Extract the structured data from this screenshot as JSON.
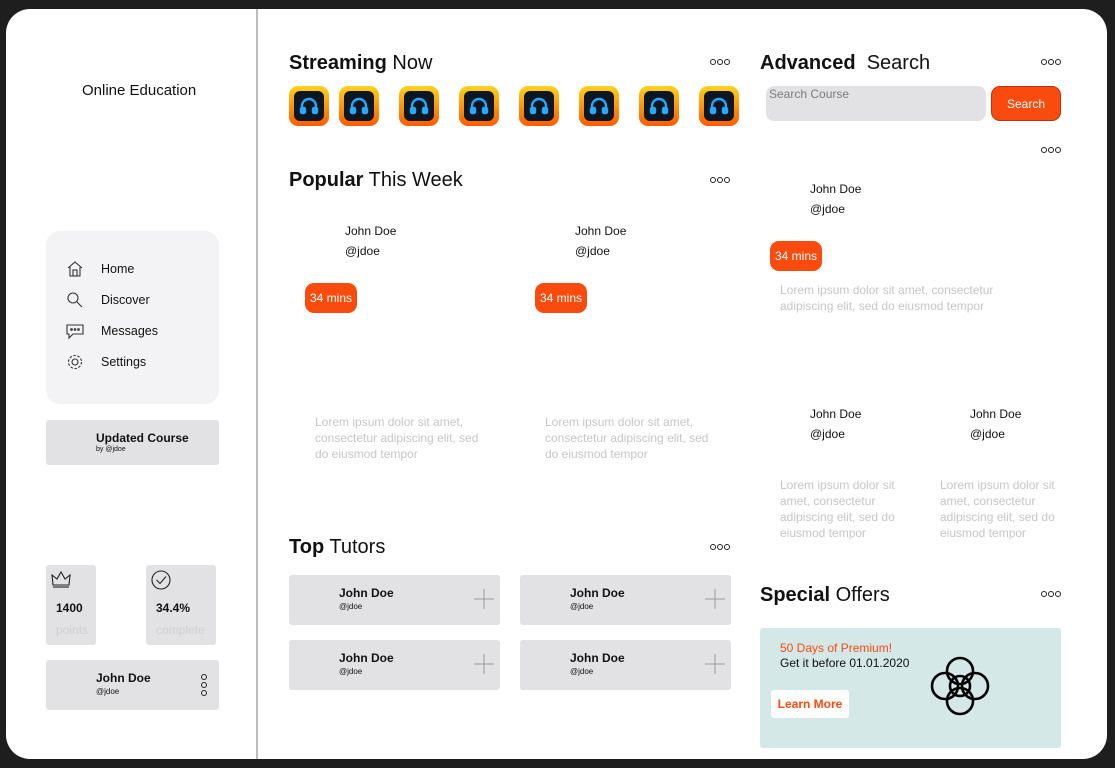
{
  "app": {
    "title": "Online Education"
  },
  "nav": {
    "items": [
      {
        "label": "Home",
        "icon": "home-icon"
      },
      {
        "label": "Discover",
        "icon": "discover-icon"
      },
      {
        "label": "Messages",
        "icon": "messages-icon"
      },
      {
        "label": "Settings",
        "icon": "settings-icon"
      }
    ]
  },
  "updated_course": {
    "title": "Updated Course",
    "by": "by @jdoe"
  },
  "stats": [
    {
      "value": "1400",
      "label": "points",
      "icon": "crown-icon"
    },
    {
      "value": "34.4%",
      "label": "complete",
      "icon": "check-circle-icon"
    }
  ],
  "profile": {
    "name": "John Doe",
    "handle": "@jdoe"
  },
  "streaming": {
    "title_bold": "Streaming",
    "title_rest": "Now",
    "count": 8,
    "icon": "headphones-icon"
  },
  "popular": {
    "title_bold": "Popular",
    "title_rest": "This Week",
    "cards": [
      {
        "name": "John Doe",
        "handle": "@jdoe",
        "duration": "34 mins",
        "description": "Lorem ipsum dolor sit amet, consectetur adipiscing elit, sed do eiusmod tempor"
      },
      {
        "name": "John Doe",
        "handle": "@jdoe",
        "duration": "34 mins",
        "description": "Lorem ipsum dolor sit amet, consectetur adipiscing elit, sed do eiusmod tempor"
      }
    ]
  },
  "tutors": {
    "title_bold": "Top",
    "title_rest": "Tutors",
    "items": [
      {
        "name": "John Doe",
        "handle": "@jdoe"
      },
      {
        "name": "John Doe",
        "handle": "@jdoe"
      },
      {
        "name": "John Doe",
        "handle": "@jdoe"
      },
      {
        "name": "John Doe",
        "handle": "@jdoe"
      }
    ]
  },
  "search": {
    "title_bold": "Advanced",
    "title_rest": "Search",
    "placeholder": "Search Course",
    "button": "Search"
  },
  "results": {
    "featured": {
      "name": "John Doe",
      "handle": "@jdoe",
      "duration": "34 mins",
      "description": "Lorem ipsum dolor sit amet, consectetur adipiscing elit, sed do eiusmod tempor"
    },
    "items": [
      {
        "name": "John Doe",
        "handle": "@jdoe",
        "description": "Lorem ipsum dolor sit amet, consectetur adipiscing elit, sed do eiusmod tempor"
      },
      {
        "name": "John Doe",
        "handle": "@jdoe",
        "description": "Lorem ipsum dolor sit amet, consectetur adipiscing elit, sed do eiusmod tempor"
      }
    ]
  },
  "offers": {
    "title_bold": "Special",
    "title_rest": "Offers",
    "headline": "50 Days of Premium!",
    "subline": "Get it before 01.01.2020",
    "button": "Learn More",
    "icon": "flower-knot-icon"
  },
  "colors": {
    "accent": "#fa4b0f",
    "card": "#e2e2e4",
    "offer_bg": "#d5e8e8"
  }
}
